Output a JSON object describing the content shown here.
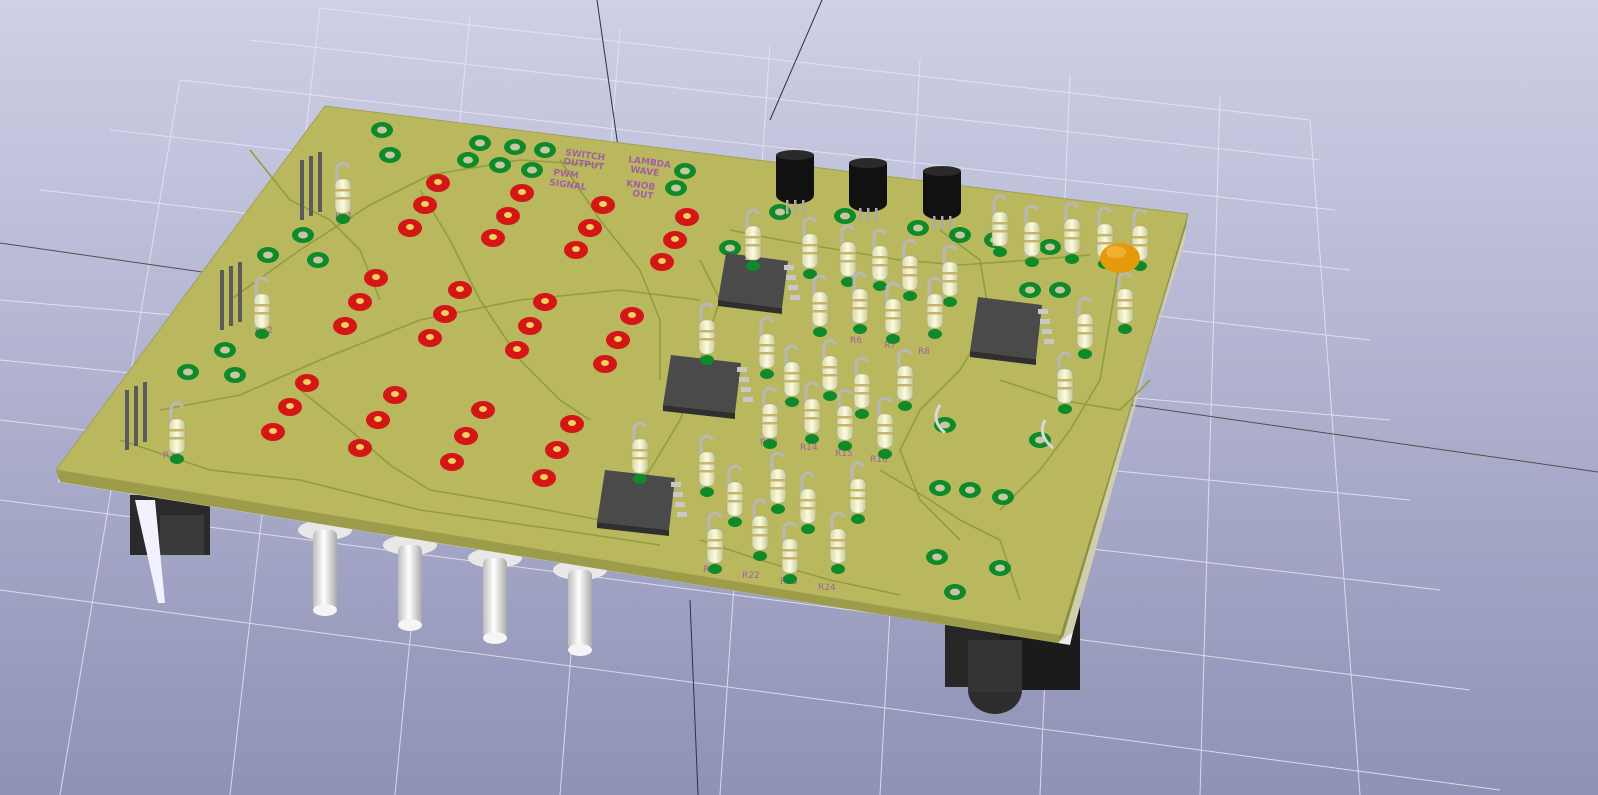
{
  "viewer": {
    "name": "3D PCB viewer"
  },
  "colors": {
    "background_top": "#c7c8de",
    "background_bottom": "#8e90b8",
    "board_top": "#b9b85f",
    "board_edge": "#9d9c4a",
    "trace": "#8f9c3c",
    "pad_ring": "#0f8a2a",
    "red_pad": "#d41616",
    "ic_body": "#4a4a4a",
    "resistor_body": "#f0f0c0",
    "transistor_body": "#111111",
    "capacitor_body": "#e59a0c",
    "silkscreen": "#a45fa0"
  },
  "board": {
    "silkscreen_labels": {
      "switch_output": [
        "SWITCH",
        "OUTPUT"
      ],
      "pwm_signal": [
        "PWM",
        "SIGNAL"
      ],
      "lambda_wave": [
        "LAMBDA",
        "WAVE"
      ],
      "knob_out": [
        "KNOB",
        "OUT"
      ],
      "r31": "R31",
      "r32": "R32",
      "r33": "R33",
      "r13": "R13",
      "r14": "R14",
      "r15": "R15",
      "r16": "R16",
      "r21": "R21",
      "r22": "R22",
      "r23": "R23",
      "r24": "R24",
      "r6": "R6",
      "r7": "R7",
      "r8": "R8"
    }
  }
}
